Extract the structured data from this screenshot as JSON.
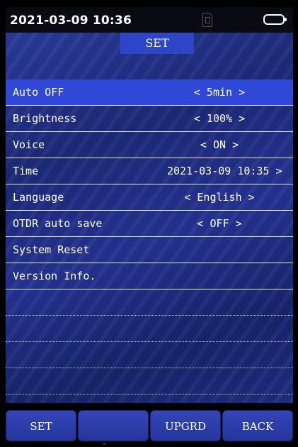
{
  "status_bar": {
    "datetime": "2021-03-09 10:36",
    "sd_icon": "sd-card-icon",
    "battery_icon": "battery-icon"
  },
  "page": {
    "title": "SET"
  },
  "settings": [
    {
      "label": "Auto OFF",
      "value": "< 5min >",
      "selected": true
    },
    {
      "label": "Brightness",
      "value": "< 100% >",
      "selected": false
    },
    {
      "label": "Voice",
      "value": "< ON >",
      "selected": false
    },
    {
      "label": "Time",
      "value": "2021-03-09 10:35 >",
      "selected": false
    },
    {
      "label": "Language",
      "value": "< English >",
      "selected": false
    },
    {
      "label": "OTDR auto save",
      "value": "< OFF >",
      "selected": false
    },
    {
      "label": "System Reset",
      "value": "",
      "selected": false
    },
    {
      "label": "Version Info.",
      "value": "",
      "selected": false
    }
  ],
  "softkeys": [
    {
      "label": "SET"
    },
    {
      "label": ""
    },
    {
      "label": "UPGRD"
    },
    {
      "label": "BACK"
    }
  ],
  "colors": {
    "panel_blue": "#1f2c80",
    "selected_row": "#3048d8",
    "title_tab": "#2f45c8"
  }
}
